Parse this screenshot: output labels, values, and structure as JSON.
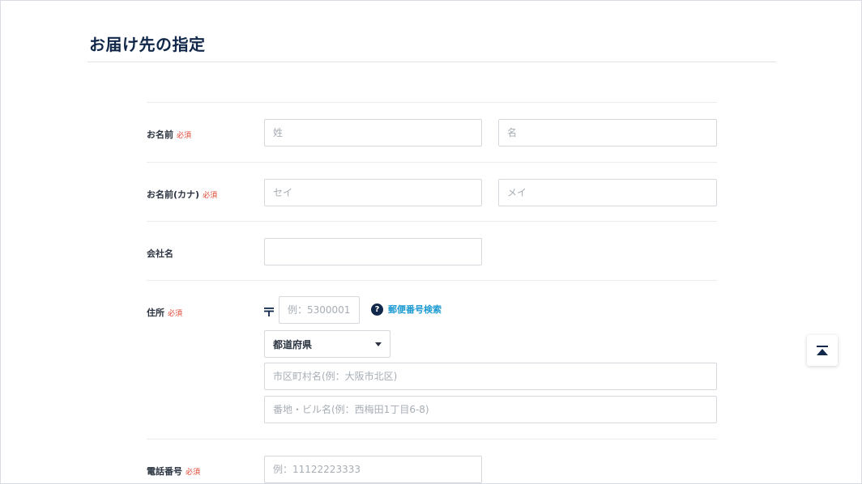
{
  "page": {
    "title": "お届け先の指定"
  },
  "form": {
    "required_label": "必須",
    "name": {
      "label": "お名前",
      "last_placeholder": "姓",
      "first_placeholder": "名"
    },
    "kana": {
      "label": "お名前(カナ)",
      "last_placeholder": "セイ",
      "first_placeholder": "メイ"
    },
    "company": {
      "label": "会社名",
      "placeholder": ""
    },
    "address": {
      "label": "住所",
      "postal_mark": "〒",
      "postal_placeholder": "例：5300001",
      "postal_search_label": "郵便番号検索",
      "prefecture_value": "都道府県",
      "city_placeholder": "市区町村名(例：大阪市北区)",
      "street_placeholder": "番地・ビル名(例：西梅田1丁目6-8)"
    },
    "phone": {
      "label": "電話番号",
      "placeholder": "例：11122223333"
    }
  },
  "icons": {
    "help": "question-circle-icon",
    "dropdown": "caret-down-icon",
    "back_to_top": "arrow-up-to-top-icon"
  },
  "colors": {
    "title": "#12284a",
    "required": "#e0432e",
    "link": "#1a9ad1"
  }
}
